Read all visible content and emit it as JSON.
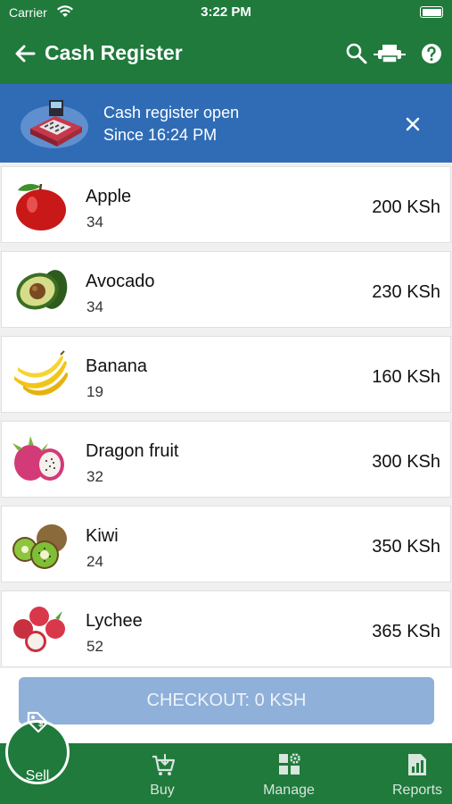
{
  "status_bar": {
    "carrier": "Carrier",
    "time": "3:22 PM"
  },
  "app_bar": {
    "title": "Cash Register"
  },
  "banner": {
    "line1": "Cash register open",
    "line2": "Since 16:24 PM"
  },
  "products": [
    {
      "name": "Apple",
      "qty": "34",
      "price": "200 KSh",
      "icon": "apple-icon"
    },
    {
      "name": "Avocado",
      "qty": "34",
      "price": "230 KSh",
      "icon": "avocado-icon"
    },
    {
      "name": "Banana",
      "qty": "19",
      "price": "160 KSh",
      "icon": "banana-icon"
    },
    {
      "name": "Dragon fruit",
      "qty": "32",
      "price": "300 KSh",
      "icon": "dragon-fruit-icon"
    },
    {
      "name": "Kiwi",
      "qty": "24",
      "price": "350 KSh",
      "icon": "kiwi-icon"
    },
    {
      "name": "Lychee",
      "qty": "52",
      "price": "365 KSh",
      "icon": "lychee-icon"
    }
  ],
  "checkout": {
    "label": "CHECKOUT: 0 KSH"
  },
  "tabs": [
    {
      "label": "Sell",
      "icon": "price-tag-icon",
      "active": true
    },
    {
      "label": "Buy",
      "icon": "cart-icon",
      "active": false
    },
    {
      "label": "Manage",
      "icon": "grid-settings-icon",
      "active": false
    },
    {
      "label": "Reports",
      "icon": "report-chart-icon",
      "active": false
    }
  ],
  "colors": {
    "primary": "#1f7a3c",
    "banner": "#2f6cb5",
    "checkout_disabled": "#8fb0d9"
  }
}
